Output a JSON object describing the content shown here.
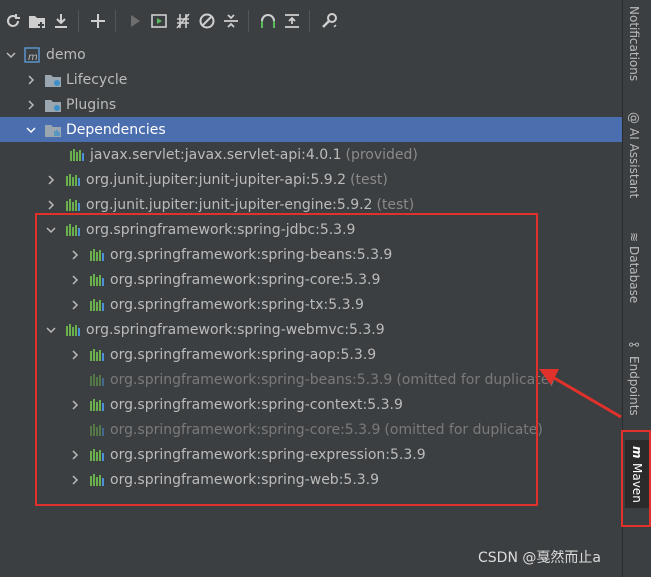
{
  "toolbar": {
    "buttons": [
      "reload-icon",
      "add-maven-project-icon",
      "download-icon",
      "plus-icon",
      "run-icon",
      "execute-goal-icon",
      "toggle-offline-icon",
      "skip-tests-icon",
      "collapse-all-icon",
      "analyze-dependencies-icon",
      "show-dependencies-icon",
      "settings-icon"
    ]
  },
  "tree": {
    "root": "demo",
    "lifecycle": "Lifecycle",
    "plugins": "Plugins",
    "dependencies": "Dependencies",
    "items": [
      {
        "label": "javax.servlet:javax.servlet-api:4.0.1",
        "note": "(provided)"
      },
      {
        "label": "org.junit.jupiter:junit-jupiter-api:5.9.2",
        "note": "(test)"
      },
      {
        "label": "org.junit.jupiter:junit-jupiter-engine:5.9.2",
        "note": "(test)"
      },
      {
        "label": "org.springframework:spring-jdbc:5.3.9"
      },
      {
        "label": "org.springframework:spring-beans:5.3.9"
      },
      {
        "label": "org.springframework:spring-core:5.3.9"
      },
      {
        "label": "org.springframework:spring-tx:5.3.9"
      },
      {
        "label": "org.springframework:spring-webmvc:5.3.9"
      },
      {
        "label": "org.springframework:spring-aop:5.3.9"
      },
      {
        "label": "org.springframework:spring-beans:5.3.9",
        "note": "(omitted for duplicate)"
      },
      {
        "label": "org.springframework:spring-context:5.3.9"
      },
      {
        "label": "org.springframework:spring-core:5.3.9",
        "note": "(omitted for duplicate)"
      },
      {
        "label": "org.springframework:spring-expression:5.3.9"
      },
      {
        "label": "org.springframework:spring-web:5.3.9"
      }
    ]
  },
  "rightbar": {
    "notifications": "Notifications",
    "ai_assistant": "AI Assistant",
    "database": "Database",
    "endpoints": "Endpoints",
    "maven": "Maven"
  },
  "watermark": "CSDN @戛然而止a",
  "colors": {
    "selection": "#4b6eaf",
    "highlight": "#e0312b",
    "background": "#3c3f41"
  }
}
